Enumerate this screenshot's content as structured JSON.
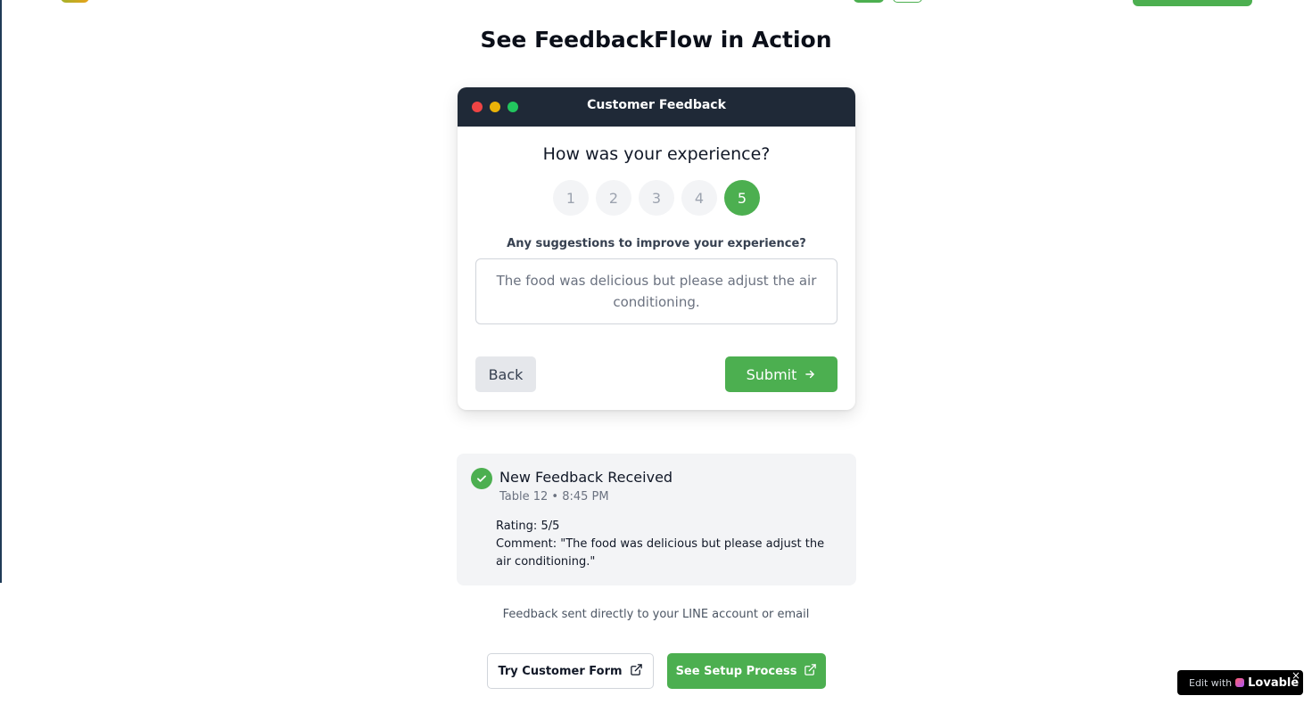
{
  "page": {
    "title": "See FeedbackFlow in Action"
  },
  "mockup": {
    "window_title": "Customer Feedback",
    "question": "How was your experience?",
    "ratings": [
      "1",
      "2",
      "3",
      "4",
      "5"
    ],
    "selected_rating": "5",
    "suggestion_label": "Any suggestions to improve your experience?",
    "suggestion_text": "The food was delicious but please adjust the air conditioning.",
    "back_label": "Back",
    "submit_label": "Submit"
  },
  "notification": {
    "title": "New Feedback Received",
    "meta": "Table 12 • 8:45 PM",
    "rating_label": "Rating:",
    "rating_value": "5/5",
    "comment_label": "Comment:",
    "comment_value": "\"The food was delicious but please adjust the air conditioning.\""
  },
  "footer": {
    "note": "Feedback sent directly to your LINE account or email",
    "try_label": "Try Customer Form",
    "setup_label": "See Setup Process"
  },
  "badge": {
    "prefix": "Edit with",
    "brand": "Lovable",
    "close": "×"
  },
  "colors": {
    "accent": "#4caf50",
    "titlebar": "#1f2937"
  }
}
